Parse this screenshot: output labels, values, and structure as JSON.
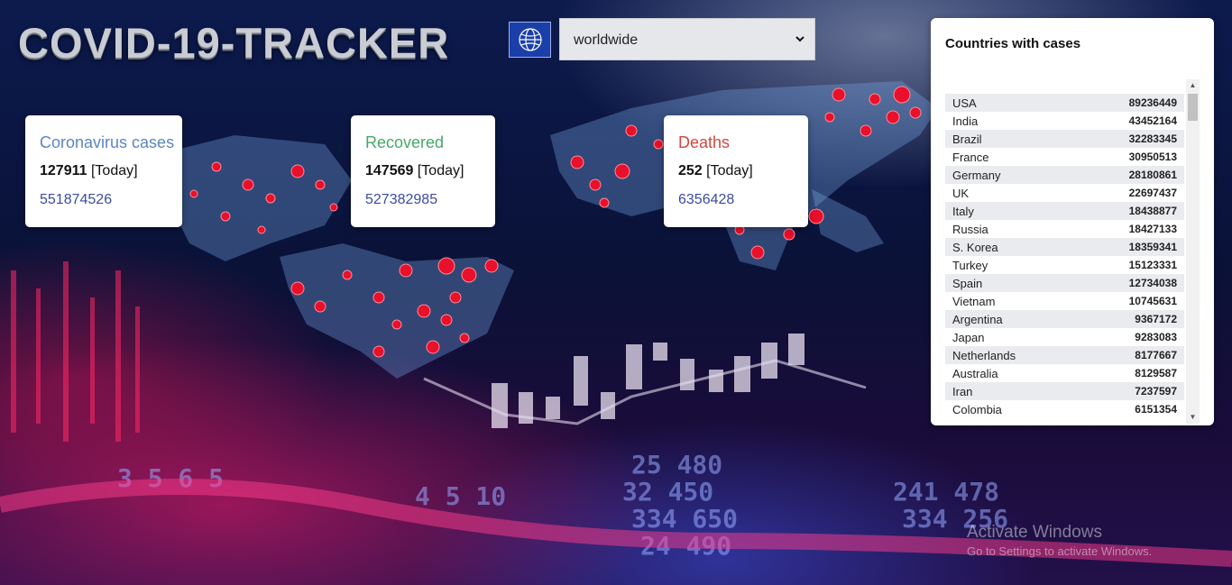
{
  "app": {
    "title": "COVID-19-TRACKER"
  },
  "header": {
    "logo_icon": "globe-icon",
    "region_select": {
      "value": "worldwide",
      "options": [
        "worldwide"
      ]
    }
  },
  "stats": {
    "cases": {
      "label": "Coronavirus cases",
      "today": "127911",
      "today_suffix": "[Today]",
      "total": "551874526",
      "color": "#5a86c2"
    },
    "recovered": {
      "label": "Recovered",
      "today": "147569",
      "today_suffix": "[Today]",
      "total": "527382985",
      "color": "#47a86a"
    },
    "deaths": {
      "label": "Deaths",
      "today": "252",
      "today_suffix": "[Today]",
      "total": "6356428",
      "color": "#d2473e"
    }
  },
  "countries_panel": {
    "title": "Countries with cases",
    "rows": [
      {
        "country": "USA",
        "cases": "89236449"
      },
      {
        "country": "India",
        "cases": "43452164"
      },
      {
        "country": "Brazil",
        "cases": "32283345"
      },
      {
        "country": "France",
        "cases": "30950513"
      },
      {
        "country": "Germany",
        "cases": "28180861"
      },
      {
        "country": "UK",
        "cases": "22697437"
      },
      {
        "country": "Italy",
        "cases": "18438877"
      },
      {
        "country": "Russia",
        "cases": "18427133"
      },
      {
        "country": "S. Korea",
        "cases": "18359341"
      },
      {
        "country": "Turkey",
        "cases": "15123331"
      },
      {
        "country": "Spain",
        "cases": "12734038"
      },
      {
        "country": "Vietnam",
        "cases": "10745631"
      },
      {
        "country": "Argentina",
        "cases": "9367172"
      },
      {
        "country": "Japan",
        "cases": "9283083"
      },
      {
        "country": "Netherlands",
        "cases": "8177667"
      },
      {
        "country": "Australia",
        "cases": "8129587"
      },
      {
        "country": "Iran",
        "cases": "7237597"
      },
      {
        "country": "Colombia",
        "cases": "6151354"
      }
    ]
  },
  "watermark": {
    "line1": "Activate Windows",
    "line2": "Go to Settings to activate Windows."
  }
}
